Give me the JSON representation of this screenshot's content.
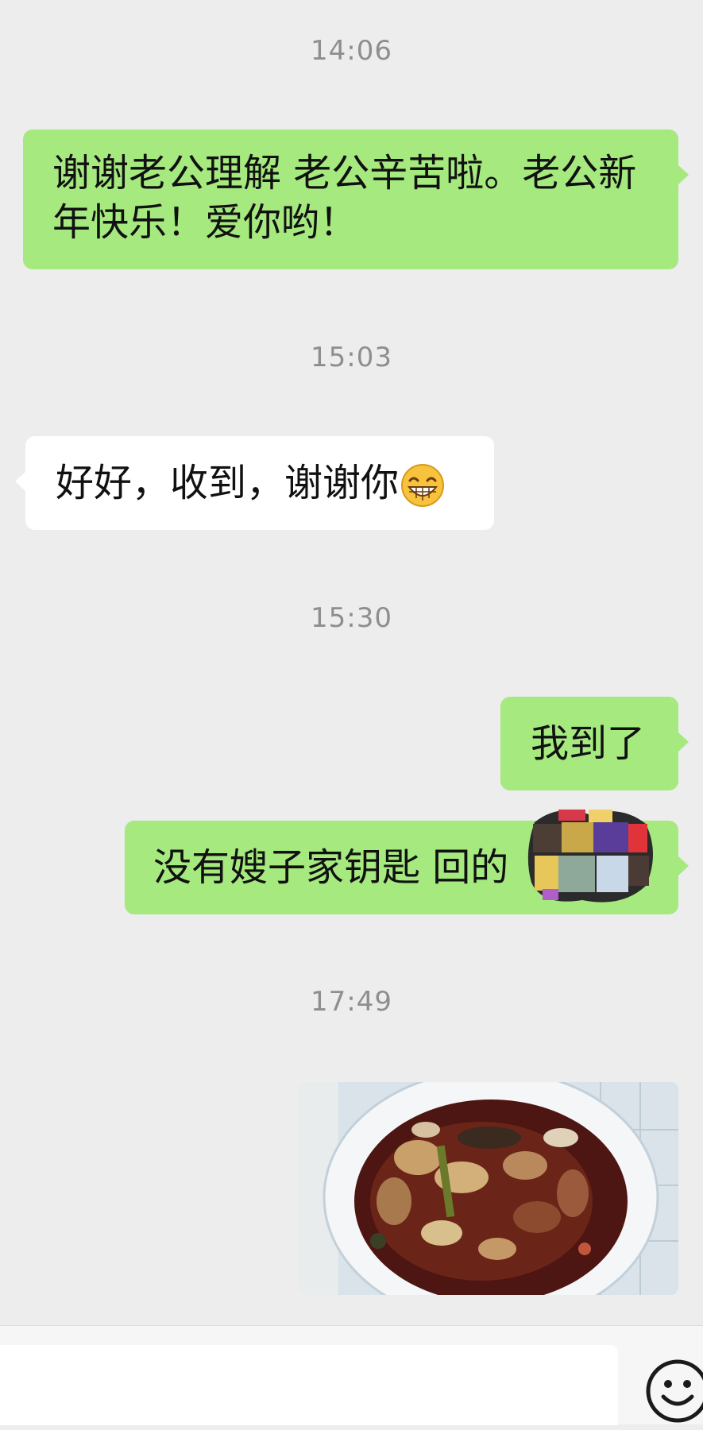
{
  "messages": [
    {
      "type": "timestamp",
      "text": "14:06"
    },
    {
      "type": "text",
      "side": "me",
      "lines": [
        "谢谢老公理解 老公辛苦啦。老公新",
        "年快乐！爱你哟！"
      ]
    },
    {
      "type": "timestamp",
      "text": "15:03"
    },
    {
      "type": "text",
      "side": "them",
      "text": "好好，收到，谢谢你",
      "emoji": "grin-emoji"
    },
    {
      "type": "timestamp",
      "text": "15:30"
    },
    {
      "type": "text",
      "side": "me",
      "text": "我到了"
    },
    {
      "type": "text",
      "side": "me",
      "text": "没有嫂子家钥匙 回的",
      "redaction": "mosaic-sticker"
    },
    {
      "type": "timestamp",
      "text": "17:49"
    },
    {
      "type": "image",
      "side": "me",
      "content": "photo-food-bowl"
    }
  ],
  "input": {
    "placeholder": "",
    "value": ""
  },
  "icons": {
    "emoji_button": "smiley-icon"
  },
  "colors": {
    "background": "#ededed",
    "me_bubble": "#a5e97f",
    "them_bubble": "#ffffff",
    "timestamp": "#8e8e8e"
  }
}
